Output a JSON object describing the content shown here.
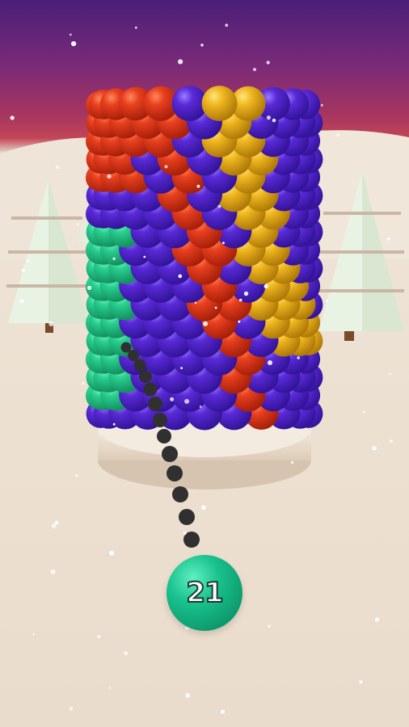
{
  "shooter": {
    "count": "21",
    "color": "#19c28e"
  },
  "colors": {
    "red": "#e8401f",
    "purple": "#5a2ad8",
    "yellow": "#f0b820",
    "green": "#28d08f"
  }
}
